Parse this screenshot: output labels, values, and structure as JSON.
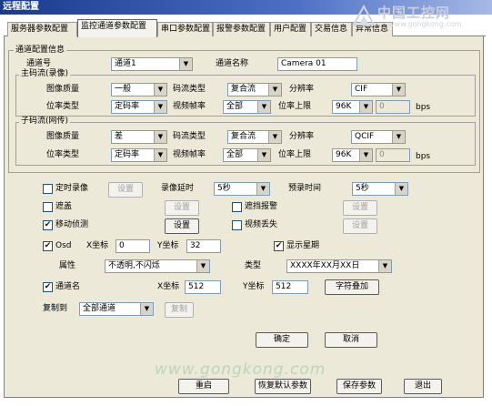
{
  "window": {
    "title": "远程配置"
  },
  "watermark": {
    "cn": "中国工控网",
    "url": "www.gongkong.com",
    "url2": "www.gongkong.com"
  },
  "tabs": [
    {
      "label": "服务器参数配置"
    },
    {
      "label": "监控通道参数配置"
    },
    {
      "label": "串口参数配置"
    },
    {
      "label": "报警参数配置"
    },
    {
      "label": "用户配置"
    },
    {
      "label": "交易信息"
    },
    {
      "label": "异常信息"
    }
  ],
  "channel_group": {
    "title": "通道配置信息",
    "channel_no_label": "通道号",
    "channel_no_value": "通道1",
    "channel_name_label": "通道名称",
    "channel_name_value": "Camera 01"
  },
  "main_stream": {
    "title": "主码流(录像)",
    "quality_label": "图像质量",
    "quality_value": "一般",
    "stream_type_label": "码流类型",
    "stream_type_value": "复合流",
    "resolution_label": "分辨率",
    "resolution_value": "CIF",
    "bitrate_type_label": "位率类型",
    "bitrate_type_value": "定码率",
    "framerate_label": "视频帧率",
    "framerate_value": "全部",
    "bitrate_limit_label": "位率上限",
    "bitrate_limit_value": "96K",
    "bitrate_custom_value": "0",
    "bps_label": "bps"
  },
  "sub_stream": {
    "title": "子码流(网传)",
    "quality_label": "图像质量",
    "quality_value": "差",
    "stream_type_label": "码流类型",
    "stream_type_value": "复合流",
    "resolution_label": "分辨率",
    "resolution_value": "QCIF",
    "bitrate_type_label": "位率类型",
    "bitrate_type_value": "定码率",
    "framerate_label": "视频帧率",
    "framerate_value": "全部",
    "bitrate_limit_label": "位率上限",
    "bitrate_limit_value": "96K",
    "bitrate_custom_value": "0",
    "bps_label": "bps"
  },
  "options": {
    "timed_record_label": "定时录像",
    "timed_record_checked": false,
    "settings_label": "设置",
    "record_delay_label": "录像延时",
    "record_delay_value": "5秒",
    "prerecord_label": "预录时间",
    "prerecord_value": "5秒",
    "mask_label": "遮盖",
    "mask_checked": false,
    "block_alarm_label": "遮挡报警",
    "block_alarm_checked": false,
    "motion_label": "移动侦测",
    "motion_checked": true,
    "video_loss_label": "视频丢失",
    "video_loss_checked": false
  },
  "osd": {
    "osd_label": "Osd",
    "osd_checked": true,
    "x_label": "X坐标",
    "x_value": "0",
    "y_label": "Y坐标",
    "y_value": "32",
    "show_week_label": "显示星期",
    "show_week_checked": true,
    "attr_label": "属性",
    "attr_value": "不透明,不闪烁",
    "type_label": "类型",
    "type_value": "XXXX年XX月XX日"
  },
  "channel_name_osd": {
    "label": "通道名",
    "checked": true,
    "x_label": "X坐标",
    "x_value": "512",
    "y_label": "Y坐标",
    "y_value": "512",
    "overlay_button": "字符叠加"
  },
  "copy": {
    "label": "复制到",
    "value": "全部通道",
    "button": "复制"
  },
  "dialog_buttons": {
    "ok": "确定",
    "cancel": "取消"
  },
  "footer_buttons": {
    "restart": "重启",
    "restore_default": "恢复默认参数",
    "save": "保存参数",
    "exit": "退出"
  }
}
